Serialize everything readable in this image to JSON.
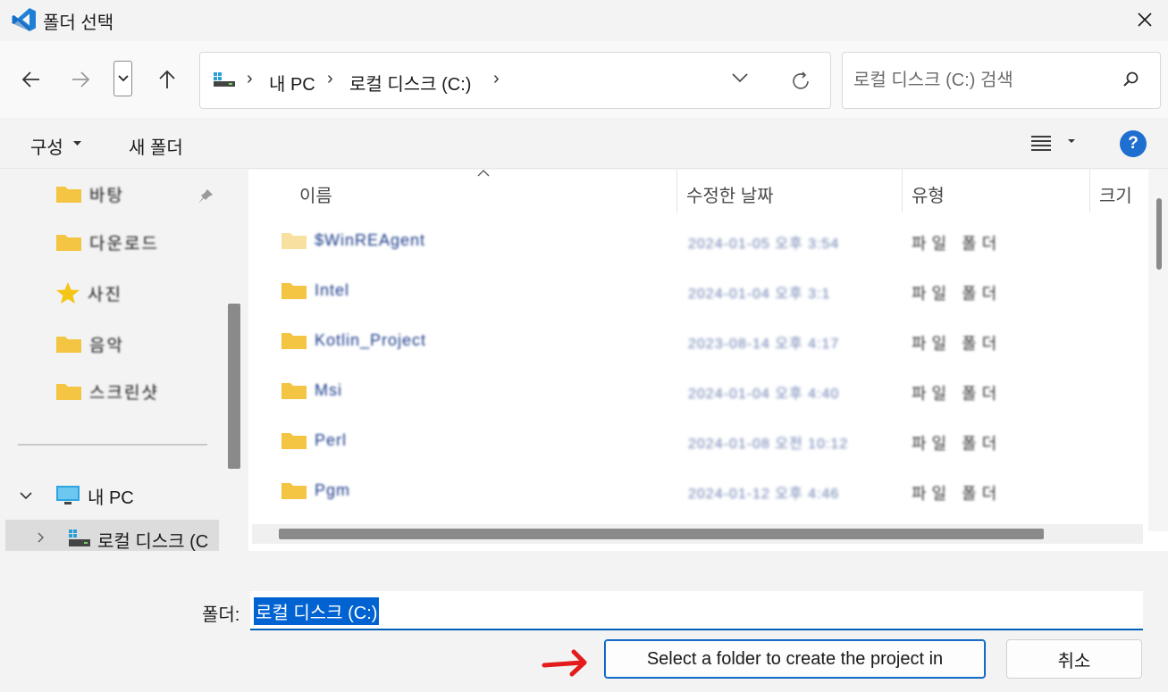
{
  "window": {
    "title": "폴더 선택",
    "app_icon": "vscode-icon",
    "close_icon": "close-icon"
  },
  "address": {
    "crumbs": [
      "내 PC",
      "로컬 디스크 (C:)"
    ],
    "search_placeholder": "로컬 디스크 (C:) 검색"
  },
  "toolbar": {
    "organize_label": "구성",
    "new_folder_label": "새 폴더",
    "help_label": "?"
  },
  "nav": {
    "quick_items": [
      {
        "label": "바탕",
        "icon": "folder-icon"
      },
      {
        "label": "다운로드",
        "icon": "folder-icon"
      },
      {
        "label": "사진",
        "icon": "star-icon"
      },
      {
        "label": "음악",
        "icon": "folder-icon"
      },
      {
        "label": "스크린샷",
        "icon": "folder-icon"
      }
    ],
    "mypc_label": "내 PC",
    "local_disk_label": "로컬 디스크 (C"
  },
  "columns": {
    "name": "이름",
    "modified": "수정한 날짜",
    "type": "유형",
    "size": "크기"
  },
  "files": [
    {
      "name": "$WinREAgent",
      "date": "2024-01-05 오후 3:54",
      "type": "파일 폴더"
    },
    {
      "name": "Intel",
      "date": "2024-01-04 오후 3:1",
      "type": "파일 폴더"
    },
    {
      "name": "Kotlin_Project",
      "date": "2023-08-14 오후 4:17",
      "type": "파일 폴더"
    },
    {
      "name": "Msi",
      "date": "2024-01-04 오후 4:40",
      "type": "파일 폴더"
    },
    {
      "name": "Perl",
      "date": "2024-01-08 오전 10:12",
      "type": "파일 폴더"
    },
    {
      "name": "Pgm",
      "date": "2024-01-12 오후 4:46",
      "type": "파일 폴더"
    }
  ],
  "footer": {
    "folder_label": "폴더:",
    "folder_value": "로컬 디스크 (C:)",
    "select_button": "Select a folder to create the project in",
    "cancel_button": "취소"
  },
  "colors": {
    "accent": "#005fb8",
    "selection": "#0063d1",
    "folder": "#f4c542",
    "annotation_arrow": "#e31b1b"
  }
}
